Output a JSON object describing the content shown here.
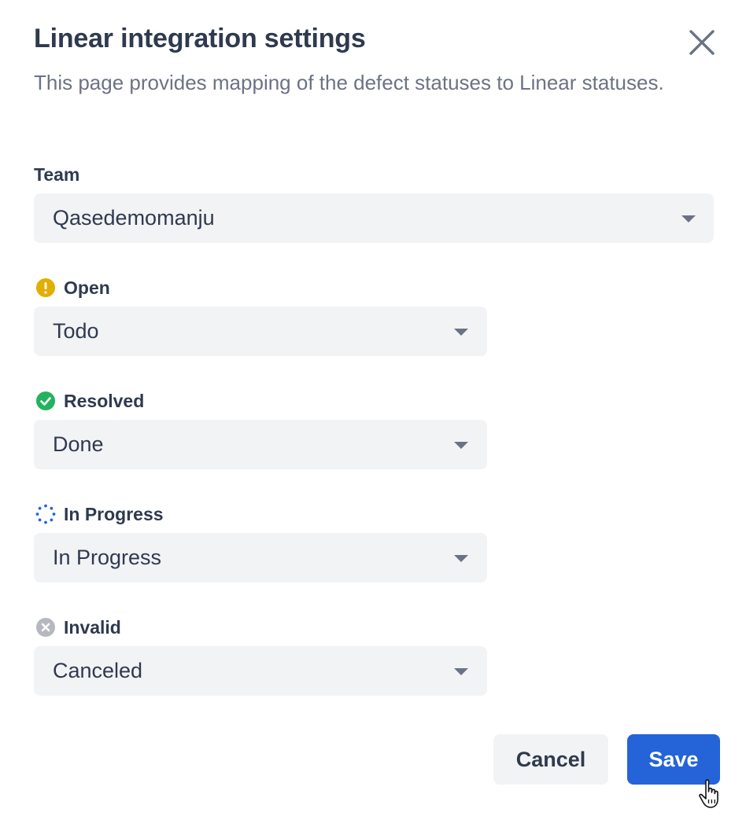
{
  "dialog": {
    "title": "Linear integration settings",
    "subtitle": "This page provides mapping of the defect statuses to Linear statuses."
  },
  "team": {
    "label": "Team",
    "value": "Qasedemomanju"
  },
  "mappings": [
    {
      "label": "Open",
      "value": "Todo",
      "icon": "open-status-icon",
      "color": "#e2ae00"
    },
    {
      "label": "Resolved",
      "value": "Done",
      "icon": "resolved-status-icon",
      "color": "#22b35e"
    },
    {
      "label": "In Progress",
      "value": "In Progress",
      "icon": "in-progress-status-icon",
      "color": "#2563d9"
    },
    {
      "label": "Invalid",
      "value": "Canceled",
      "icon": "invalid-status-icon",
      "color": "#b5b8be"
    }
  ],
  "actions": {
    "cancel_label": "Cancel",
    "save_label": "Save"
  },
  "icons": {
    "close": "close-icon",
    "dropdown": "chevron-down-icon",
    "cursor": "hand-pointer-icon"
  },
  "colors": {
    "primary": "#2563d9",
    "text": "#2f3a4f",
    "muted": "#6b7384",
    "field_bg": "#f2f3f5"
  }
}
